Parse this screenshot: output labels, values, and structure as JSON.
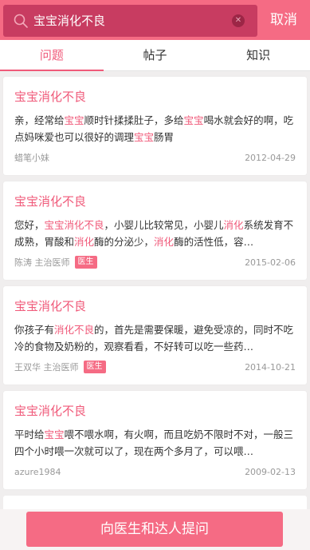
{
  "search": {
    "query": "宝宝消化不良",
    "cancel_label": "取消"
  },
  "tabs": [
    {
      "label": "问题",
      "active": true
    },
    {
      "label": "帖子",
      "active": false
    },
    {
      "label": "知识",
      "active": false
    }
  ],
  "results": [
    {
      "title": "宝宝消化不良",
      "body": [
        {
          "t": "亲，经常给"
        },
        {
          "t": "宝宝",
          "hl": true
        },
        {
          "t": "顺时针揉揉肚子，多给"
        },
        {
          "t": "宝宝",
          "hl": true
        },
        {
          "t": "喝水就会好的啊，吃点妈咪爱也可以很好的调理"
        },
        {
          "t": "宝宝",
          "hl": true
        },
        {
          "t": "肠胃"
        }
      ],
      "author": "蜡笔小妹",
      "badge": "",
      "date": "2012-04-29"
    },
    {
      "title": "宝宝消化不良",
      "body": [
        {
          "t": "您好，"
        },
        {
          "t": "宝宝消化不良",
          "hl": true
        },
        {
          "t": "，小婴儿比较常见，小婴儿"
        },
        {
          "t": "消化",
          "hl": true
        },
        {
          "t": "系统发育不成熟，胃酸和"
        },
        {
          "t": "消化",
          "hl": true
        },
        {
          "t": "酶的分泌少，"
        },
        {
          "t": "消化",
          "hl": true
        },
        {
          "t": "酶的活性低，容…"
        }
      ],
      "author": "陈涛 主治医师",
      "badge": "医生",
      "date": "2015-02-06"
    },
    {
      "title": "宝宝消化不良",
      "body": [
        {
          "t": "你孩子有"
        },
        {
          "t": "消化不良",
          "hl": true
        },
        {
          "t": "的，首先是需要保暖，避免受凉的，同时不吃冷的食物及奶粉的，观察看看，不好转可以吃一些药…"
        }
      ],
      "author": "王双华 主治医师",
      "badge": "医生",
      "date": "2014-10-21"
    },
    {
      "title": "宝宝消化不良",
      "body": [
        {
          "t": "平时给"
        },
        {
          "t": "宝宝",
          "hl": true
        },
        {
          "t": "喂不喂水啊，有火啊，而且吃奶不限时不对，一般三四个小时喂一次就可以了，现在两个多月了，可以喂…"
        }
      ],
      "author": "azure1984",
      "badge": "",
      "date": "2009-02-13"
    }
  ],
  "ask_button_label": "向医生和达人提问",
  "colors": {
    "header": "#f56b84",
    "search_box": "#c83c61",
    "highlight": "#f05a7a"
  }
}
